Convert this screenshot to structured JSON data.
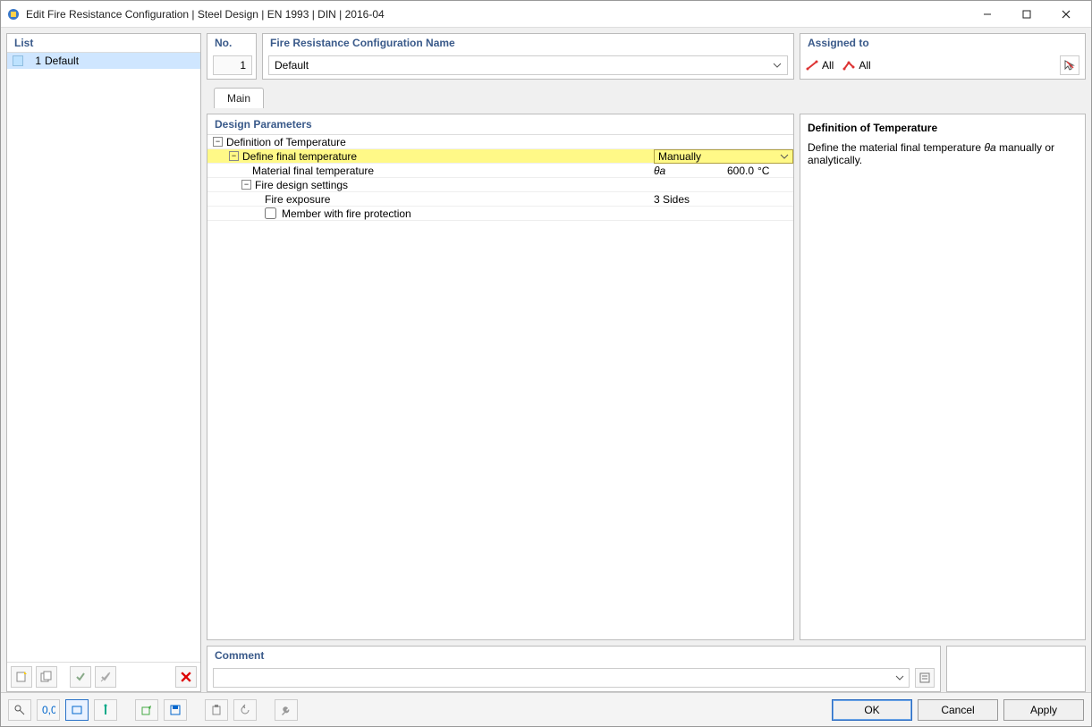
{
  "window": {
    "title": "Edit Fire Resistance Configuration | Steel Design | EN 1993 | DIN | 2016-04"
  },
  "list": {
    "heading": "List",
    "items": [
      {
        "num": "1",
        "label": "Default"
      }
    ]
  },
  "no": {
    "heading": "No.",
    "value": "1"
  },
  "cfgname": {
    "heading": "Fire Resistance Configuration Name",
    "value": "Default"
  },
  "assigned": {
    "heading": "Assigned to",
    "all1": "All",
    "all2": "All"
  },
  "tabs": {
    "main": "Main"
  },
  "params": {
    "heading": "Design Parameters",
    "root": "Definition of Temperature",
    "define_final": "Define final temperature",
    "define_final_value": "Manually",
    "mat_final": "Material final temperature",
    "mat_final_sym": "θa",
    "mat_final_val": "600.0",
    "mat_final_unit": "°C",
    "fire_settings": "Fire design settings",
    "fire_exposure": "Fire exposure",
    "fire_exposure_val": "3 Sides",
    "member_protection": "Member with fire protection"
  },
  "desc": {
    "title": "Definition of Temperature",
    "text_a": "Define the material final temperature ",
    "text_sym": "θa",
    "text_b": " manually or analytically."
  },
  "comment": {
    "heading": "Comment",
    "value": ""
  },
  "footer": {
    "ok": "OK",
    "cancel": "Cancel",
    "apply": "Apply"
  }
}
